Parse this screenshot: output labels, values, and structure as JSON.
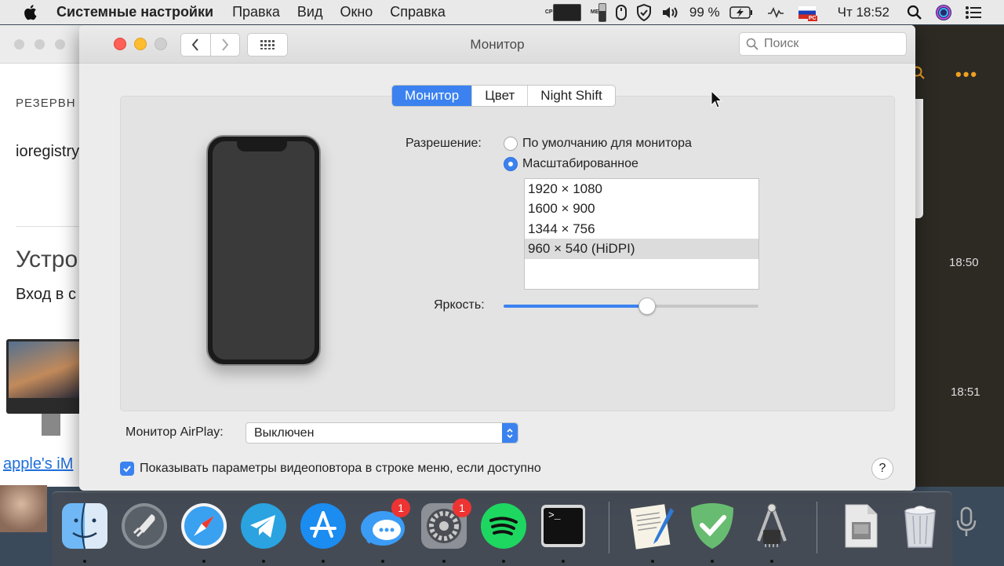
{
  "menubar": {
    "app_name": "Системные настройки",
    "items": [
      "Правка",
      "Вид",
      "Окно",
      "Справка"
    ],
    "battery": "99 %",
    "clock": "Чт 18:52",
    "cpu_label": "CPU",
    "mem_label": "MEM",
    "flag_badge": "PC"
  },
  "bg_left": {
    "heading_small": "РЕЗЕРВН",
    "text": "ioregistry",
    "heading_large": "Устро",
    "subtext": "Вход в с",
    "link": "apple's iM"
  },
  "bg_right": {
    "times": [
      "18:50",
      "18:51"
    ]
  },
  "window": {
    "title": "Монитор",
    "search_placeholder": "Поиск"
  },
  "tabs": [
    {
      "label": "Монитор",
      "active": true
    },
    {
      "label": "Цвет",
      "active": false
    },
    {
      "label": "Night Shift",
      "active": false
    }
  ],
  "resolution": {
    "label": "Разрешение:",
    "options": [
      {
        "label": "По умолчанию для монитора",
        "selected": false
      },
      {
        "label": "Масштабированное",
        "selected": true
      }
    ],
    "list": [
      "1920 × 1080",
      "1600 × 900",
      "1344 × 756",
      "960 × 540 (HiDPI)"
    ],
    "selected_index": 3
  },
  "brightness": {
    "label": "Яркость:",
    "value": 0.56
  },
  "airplay": {
    "label": "Монитор AirPlay:",
    "value": "Выключен"
  },
  "mirroring": {
    "label": "Показывать параметры видеоповтора в строке меню, если доступно",
    "checked": true
  },
  "help": "?",
  "dock": {
    "apps": [
      {
        "name": "finder"
      },
      {
        "name": "launchpad"
      },
      {
        "name": "safari"
      },
      {
        "name": "telegram"
      },
      {
        "name": "app-store"
      },
      {
        "name": "messages",
        "badge": "1"
      },
      {
        "name": "system-preferences",
        "badge": "1"
      },
      {
        "name": "spotify"
      },
      {
        "name": "terminal",
        "glyph": ">_"
      },
      {
        "name": "textedit"
      },
      {
        "name": "adguard"
      },
      {
        "name": "system-info"
      },
      {
        "name": "file"
      },
      {
        "name": "trash"
      }
    ]
  },
  "colors": {
    "accent": "#3b82f0",
    "badge": "#e33333"
  }
}
